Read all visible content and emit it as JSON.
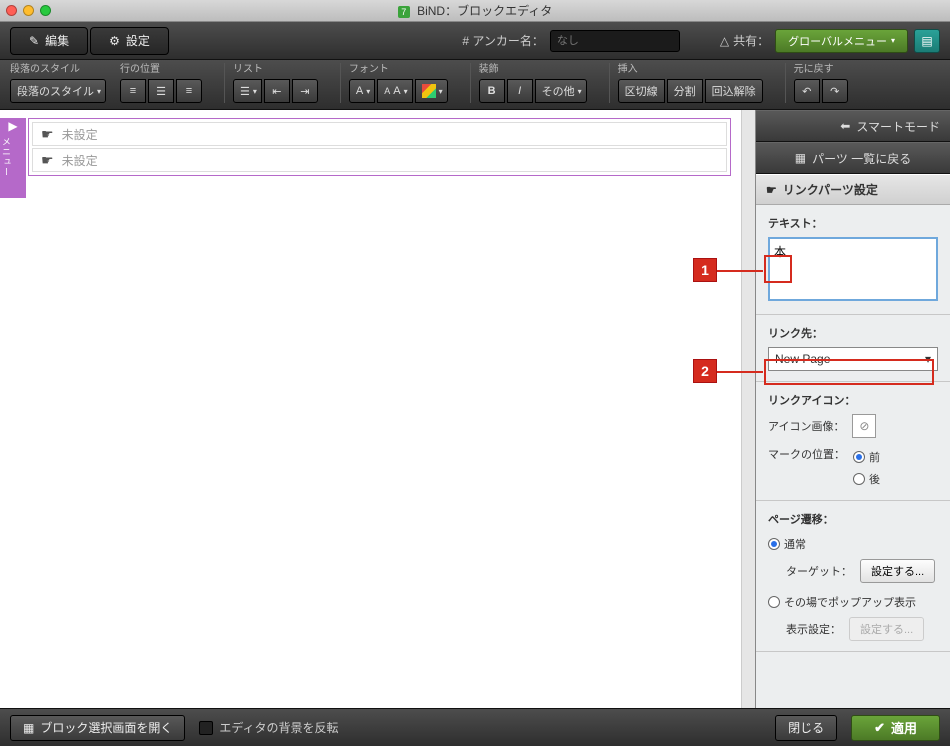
{
  "title": "BiND：ブロックエディタ",
  "app_icon_text": "7",
  "topbar": {
    "edit": "編集",
    "settings": "設定",
    "anchor_label": "# アンカー名：",
    "anchor_placeholder": "なし",
    "share": "共有：",
    "global_menu": "グローバルメニュー"
  },
  "toolbar": {
    "paragraph": {
      "label": "段落のスタイル",
      "btn": "段落のスタイル"
    },
    "line": {
      "label": "行の位置"
    },
    "list": {
      "label": "リスト"
    },
    "font": {
      "label": "フォント",
      "a": "A",
      "aa": "AA"
    },
    "decoration": {
      "label": "装飾",
      "b": "B",
      "i": "I",
      "other": "その他"
    },
    "insert": {
      "label": "挿入",
      "hr": "区切線",
      "split": "分割",
      "unwrap": "回込解除"
    },
    "undo": {
      "label": "元に戻す"
    }
  },
  "canvas": {
    "side_label": "メニュー",
    "rows": [
      "未設定",
      "未設定"
    ]
  },
  "panel": {
    "smart_mode": "スマートモード",
    "back_list": "パーツ 一覧に戻る",
    "section_title": "リンクパーツ設定",
    "text_label": "テキスト：",
    "text_value": "本",
    "link_label": "リンク先：",
    "link_value": "New Page",
    "icon_section": "リンクアイコン：",
    "icon_image": "アイコン画像：",
    "mark_pos": "マークの位置：",
    "mark_before": "前",
    "mark_after": "後",
    "transition_section": "ページ遷移：",
    "transition_normal": "通常",
    "transition_target": "ターゲット：",
    "transition_popup": "その場でポップアップ表示",
    "transition_display": "表示設定：",
    "set_btn": "設定する..."
  },
  "footer": {
    "open_block_select": "ブロック選択画面を開く",
    "invert_bg": "エディタの背景を反転",
    "close": "閉じる",
    "apply": "適用"
  },
  "callouts": {
    "one": "1",
    "two": "2"
  }
}
